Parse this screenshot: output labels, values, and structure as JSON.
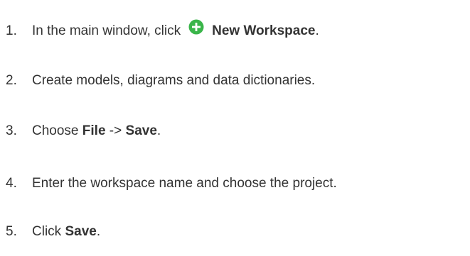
{
  "steps": [
    {
      "number": "1.",
      "before": "In the main window, click",
      "bold": "New Workspace",
      "after": ".",
      "icon": "green-plus-circle-icon",
      "icon_color": "#3ab54a"
    },
    {
      "number": "2.",
      "text": "Create models, diagrams and data dictionaries."
    },
    {
      "number": "3.",
      "before": "Choose",
      "bold1": "File",
      "middle": "->",
      "bold2": "Save",
      "after": "."
    },
    {
      "number": "4.",
      "text": "Enter the workspace name and choose the project."
    },
    {
      "number": "5.",
      "before": "Click",
      "bold": "Save",
      "after": "."
    }
  ]
}
